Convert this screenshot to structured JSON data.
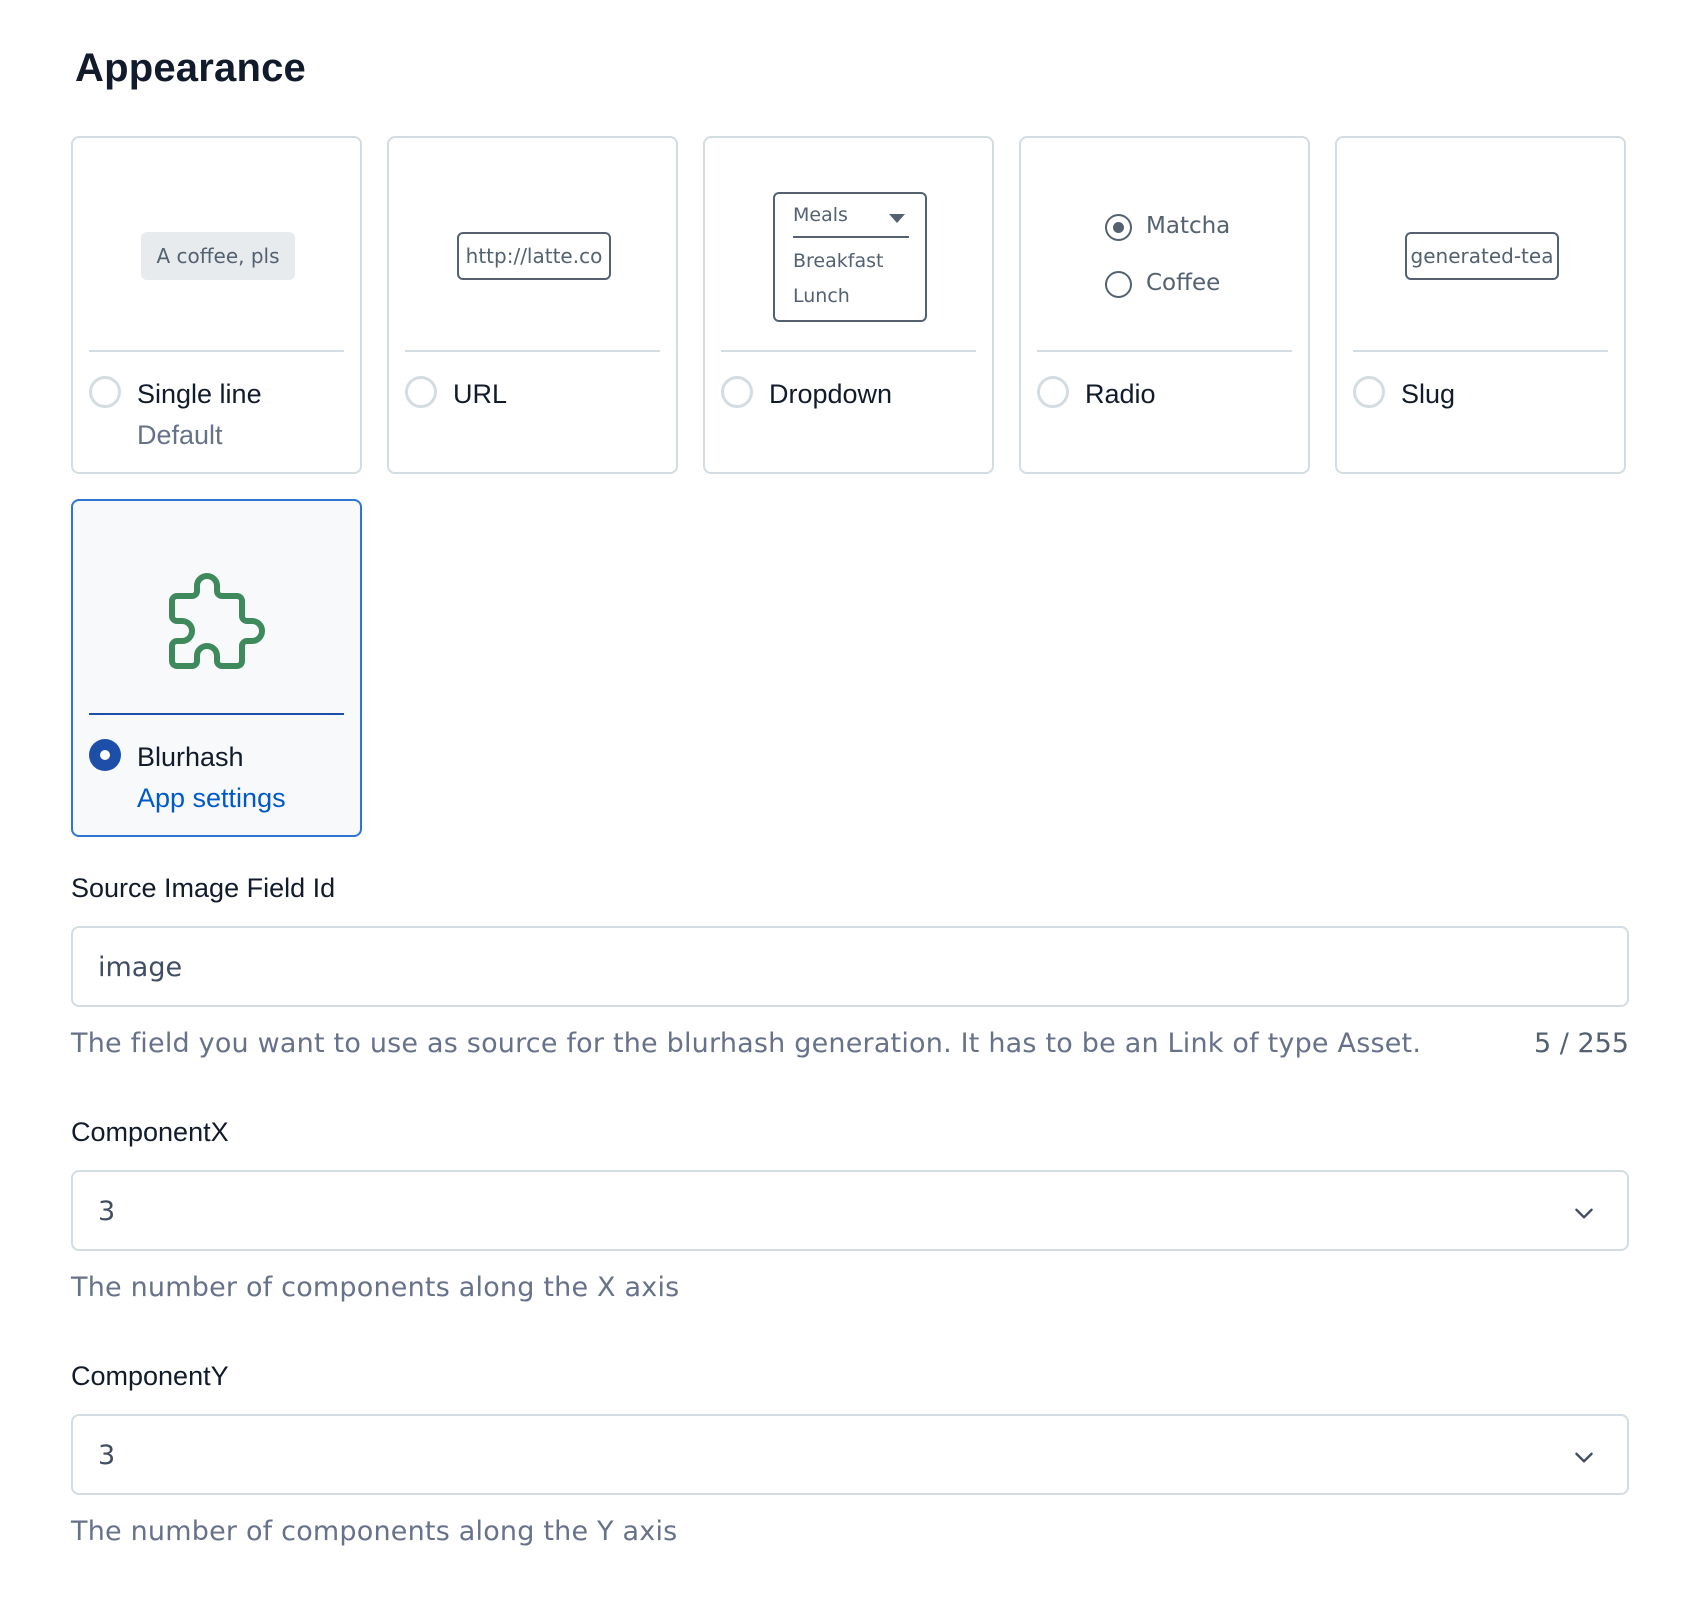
{
  "section": {
    "title": "Appearance"
  },
  "appearances": {
    "single_line": {
      "title": "Single line",
      "subtitle": "Default",
      "preview_text": "A coffee, pls"
    },
    "url": {
      "title": "URL",
      "preview_text": "http://latte.co"
    },
    "dropdown": {
      "title": "Dropdown",
      "preview_header": "Meals",
      "preview_options": [
        "Breakfast",
        "Lunch"
      ]
    },
    "radio": {
      "title": "Radio",
      "preview_options": [
        "Matcha",
        "Coffee"
      ]
    },
    "slug": {
      "title": "Slug",
      "preview_text": "generated-tea"
    },
    "blurhash": {
      "title": "Blurhash",
      "link": "App settings",
      "selected": true
    }
  },
  "fields": {
    "source_image": {
      "label": "Source Image Field Id",
      "value": "image",
      "help": "The field you want to use as source for the blurhash generation. It has to be an Link of type Asset.",
      "counter": "5 / 255"
    },
    "component_x": {
      "label": "ComponentX",
      "value": "3",
      "help": "The number of components along the X axis"
    },
    "component_y": {
      "label": "ComponentY",
      "value": "3",
      "help": "The number of components along the Y axis"
    }
  },
  "colors": {
    "accent": "#1d4fa8",
    "link": "#0059c8",
    "puzzle_icon": "#3f8a5c",
    "border": "#d3dce0"
  }
}
